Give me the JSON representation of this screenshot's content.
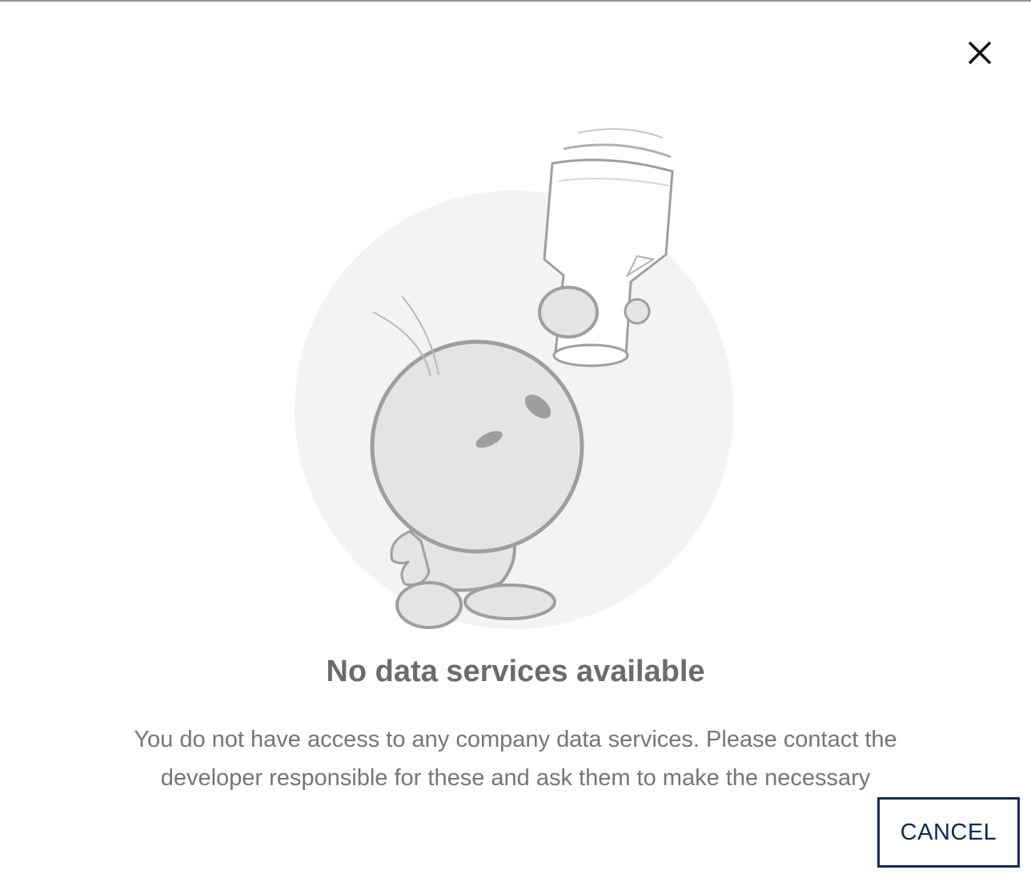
{
  "dialog": {
    "title": "No data services available",
    "message": "You do not have access to any company data services. Please contact the developer responsible for these and ask them to make the necessary",
    "cancel_label": "CANCEL"
  },
  "icons": {
    "close": "close-icon",
    "illustration": "empty-state-character-with-pitcher"
  },
  "colors": {
    "accent": "#0b2a63",
    "title": "#6b6b6b",
    "message": "#757575",
    "illustration_bg": "#f3f3f3",
    "illustration_stroke": "#9e9e9e"
  }
}
